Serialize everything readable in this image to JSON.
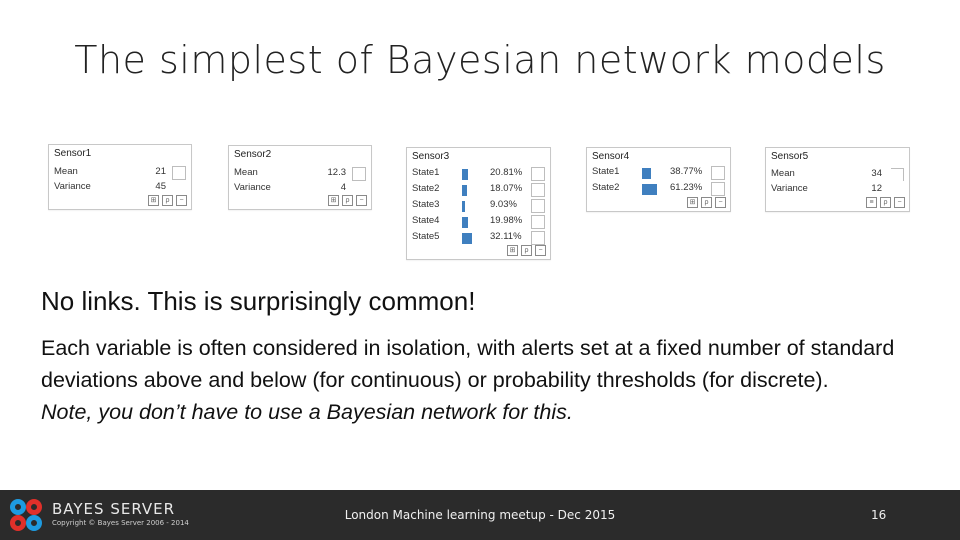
{
  "slide": {
    "title": "The simplest of Bayesian network models",
    "heading": "No links.  This is surprisingly common!",
    "paragraph": "Each variable is often considered in isolation, with alerts set at a fixed number of standard deviations above and below (for continuous) or probability thresholds (for discrete).",
    "note": "Note, you don’t have to use a Bayesian network for this."
  },
  "nodes": {
    "sensor1": {
      "name": "Sensor1",
      "mean_label": "Mean",
      "mean": "21",
      "variance_label": "Variance",
      "variance": "45"
    },
    "sensor2": {
      "name": "Sensor2",
      "mean_label": "Mean",
      "mean": "12.3",
      "variance_label": "Variance",
      "variance": "4"
    },
    "sensor3": {
      "name": "Sensor3",
      "states": [
        {
          "label": "State1",
          "pct": "20.81%",
          "value": 20.81
        },
        {
          "label": "State2",
          "pct": "18.07%",
          "value": 18.07
        },
        {
          "label": "State3",
          "pct": "9.03%",
          "value": 9.03
        },
        {
          "label": "State4",
          "pct": "19.98%",
          "value": 19.98
        },
        {
          "label": "State5",
          "pct": "32.11%",
          "value": 32.11
        }
      ]
    },
    "sensor4": {
      "name": "Sensor4",
      "states": [
        {
          "label": "State1",
          "pct": "38.77%",
          "value": 38.77
        },
        {
          "label": "State2",
          "pct": "61.23%",
          "value": 61.23
        }
      ]
    },
    "sensor5": {
      "name": "Sensor5",
      "mean_label": "Mean",
      "mean": "34",
      "variance_label": "Variance",
      "variance": "12"
    }
  },
  "footer": {
    "brand": "BAYES SERVER",
    "copyright": "Copyright © Bayes Server 2006 - 2014",
    "event": "London Machine learning meetup - Dec 2015",
    "page": "16",
    "logo_colors": {
      "blue": "#1e9be0",
      "red": "#e0302a"
    }
  },
  "colors": {
    "bar": "#3f7fbf",
    "footer_bg": "#2b2b2b"
  }
}
